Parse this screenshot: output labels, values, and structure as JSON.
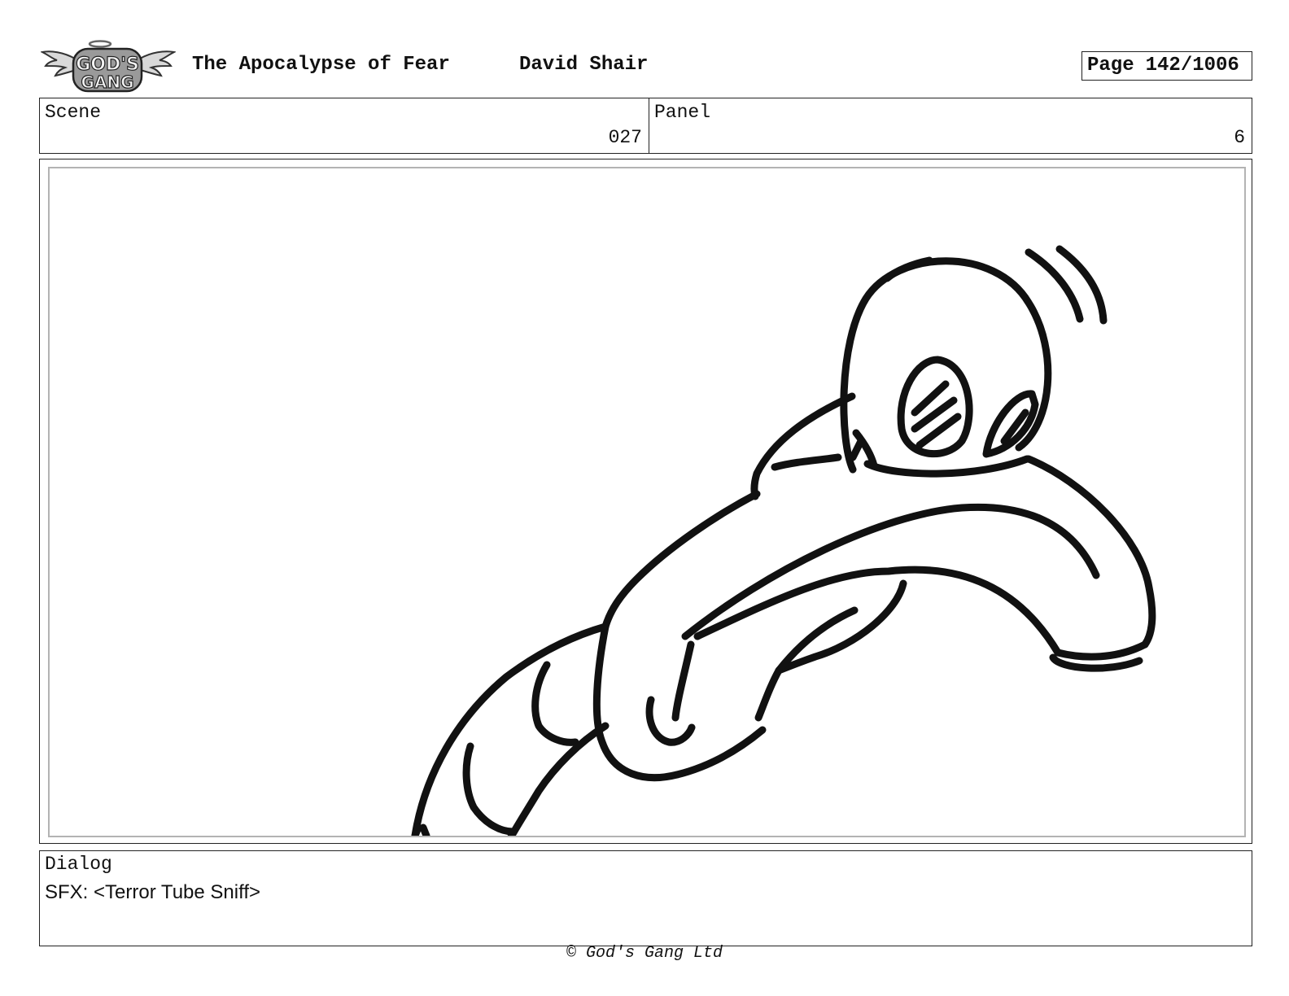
{
  "header": {
    "logo_text_top": "GOD'S",
    "logo_text_bottom": "GANG",
    "title": "The Apocalypse of Fear",
    "author": "David Shair",
    "page_label": "Page",
    "page_number": "142/1006"
  },
  "meta": {
    "scene_label": "Scene",
    "scene_value": "027",
    "panel_label": "Panel",
    "panel_value": "6"
  },
  "dialog": {
    "label": "Dialog",
    "text": "SFX: <Terror Tube Sniff>"
  },
  "footer": {
    "copyright": "© God's Gang Ltd"
  },
  "colors": {
    "ink": "#111111",
    "frame_border": "#b3b3b3"
  }
}
